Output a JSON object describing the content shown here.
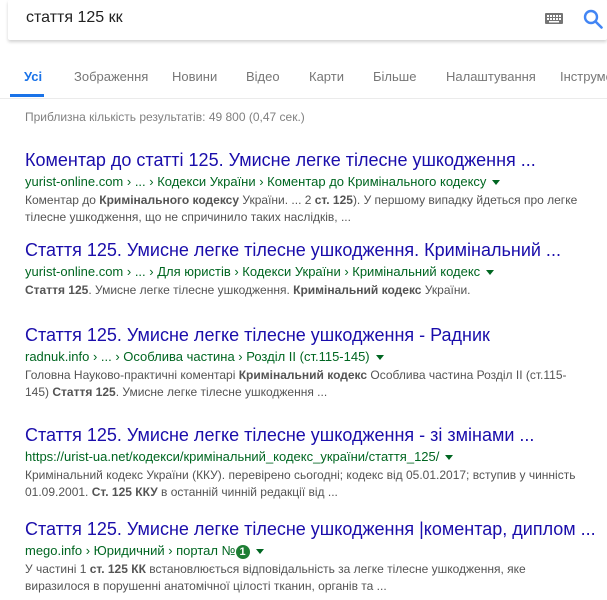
{
  "search": {
    "query": "стаття 125 кк"
  },
  "tabs": [
    "Усі",
    "Зображення",
    "Новини",
    "Відео",
    "Карти",
    "Більше",
    "Налаштування",
    "Інструменти"
  ],
  "stats": "Приблизна кількість результатів: 49 800 (0,47 сек.)",
  "results": [
    {
      "title": "Коментар до статті 125. Умисне легке тілесне ушкодження ...",
      "host": "yurist-online.com",
      "path": " › ... › Кодекси України › Коментар до Кримінального кодексу",
      "snippet": [
        {
          "t": "Коментар до "
        },
        {
          "b": "Кримінального кодексу"
        },
        {
          "t": " України. ... 2 "
        },
        {
          "b": "ст. 125"
        },
        {
          "t": "). У першому випадку йдеться про легке тілесне ушкодження, що не спричинило таких наслідків, ..."
        }
      ]
    },
    {
      "title": "Стаття 125. Умисне легке тілесне ушкодження. Кримінальний ...",
      "host": "yurist-online.com",
      "path": " › ... › Для юристів › Кодекси України › Кримінальний кодекс",
      "snippet": [
        {
          "b": "Стаття 125"
        },
        {
          "t": ". Умисне легке тілесне ушкодження. "
        },
        {
          "b": "Кримінальний кодекс"
        },
        {
          "t": " України."
        }
      ]
    },
    {
      "title": "Стаття 125. Умисне легке тілесне ушкодження - Радник",
      "host": "radnuk.info",
      "path": " › ... › Особлива частина › Розділ ІІ (ст.115-145)",
      "snippet": [
        {
          "t": "Головна Науково-практичні коментарі "
        },
        {
          "b": "Кримінальний кодекс"
        },
        {
          "t": " Особлива частина Розділ ІІ (ст.115-145) "
        },
        {
          "b": "Стаття 125"
        },
        {
          "t": ". Умисне легке тілесне ушкодження ..."
        }
      ]
    },
    {
      "title": "Стаття 125. Умисне легке тілесне ушкодження - зі змінами ...",
      "host": "https://urist-ua.net/кодекси/кримінальний_кодекс_україни/стаття_125/",
      "path": "",
      "snippet": [
        {
          "t": "Кримінальний кодекс України (ККУ). перевірено сьогодні; кодекс від 05.01.2017; вступив у чинність 01.09.2001. "
        },
        {
          "b": "Ст. 125 ККУ"
        },
        {
          "t": " в останній чинній редакції від ..."
        }
      ]
    },
    {
      "title": "Стаття 125. Умисне легке тілесне ушкодження |коментар, диплом ...",
      "host": "mego.info",
      "path": " › Юридичний › портал №",
      "badge": "1",
      "snippet": [
        {
          "t": "У частині 1 "
        },
        {
          "b": "ст. 125 КК"
        },
        {
          "t": " встановлюється відповідальність за легке тілесне ушкодження, яке виразилося в порушенні анатомічної цілості тканин, органів та ..."
        }
      ]
    }
  ]
}
